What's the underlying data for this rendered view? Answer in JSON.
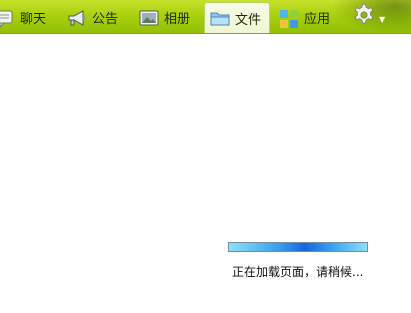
{
  "toolbar": {
    "tabs": [
      {
        "id": "chat",
        "label": "聊天",
        "icon": "chat-icon"
      },
      {
        "id": "notice",
        "label": "公告",
        "icon": "megaphone-icon"
      },
      {
        "id": "album",
        "label": "相册",
        "icon": "photo-album-icon"
      },
      {
        "id": "files",
        "label": "文件",
        "icon": "folder-icon",
        "active": true
      },
      {
        "id": "apps",
        "label": "应用",
        "icon": "apps-grid-icon"
      }
    ],
    "settings_icon": "gear-icon",
    "accent_color": "#a9d10f"
  },
  "loading": {
    "progress": 1.0,
    "text": "正在加载页面，请稍候..."
  }
}
